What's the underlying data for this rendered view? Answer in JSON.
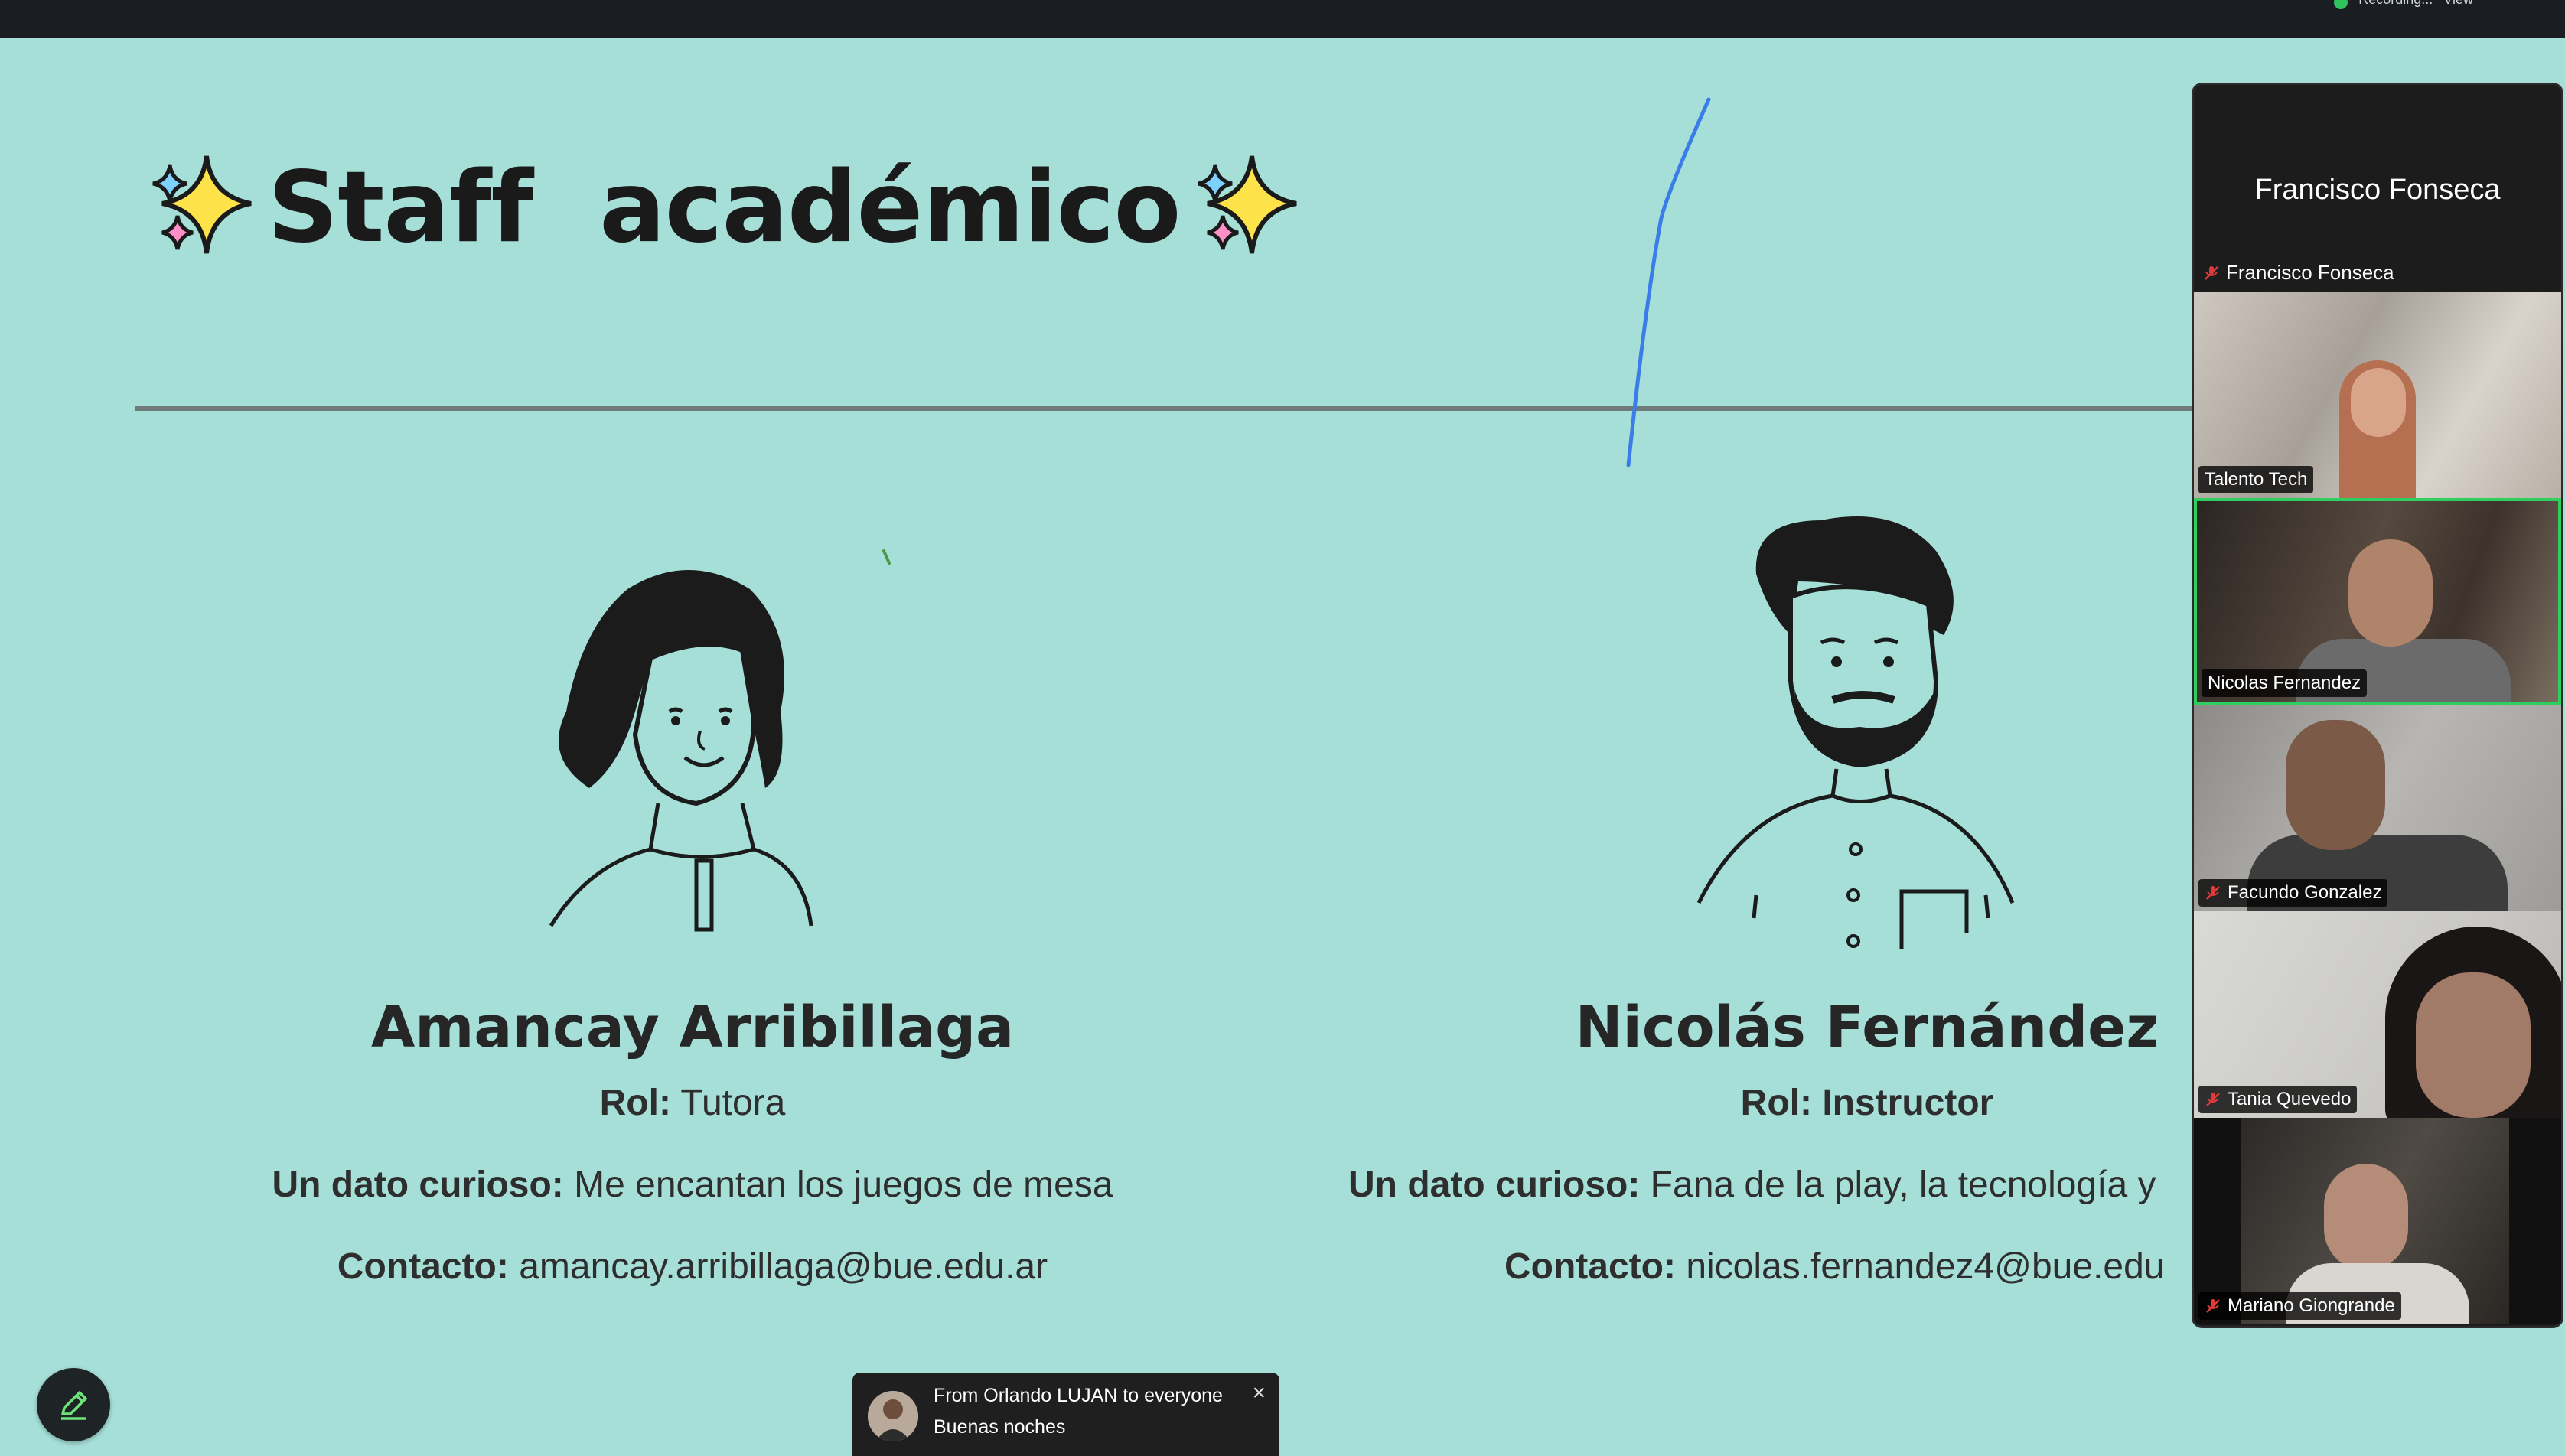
{
  "top_bar": {
    "recording_text": "Recording...",
    "view_label": "View"
  },
  "slide": {
    "title": "Staff  académico",
    "staff": [
      {
        "name": "Amancay Arribillaga",
        "rol_label": "Rol:",
        "rol_value": "Tutora",
        "dato_label": "Un dato curioso:",
        "dato_value": "Me encantan los juegos de mesa",
        "contacto_label": "Contacto:",
        "contacto_value": "amancay.arribillaga@bue.edu.ar"
      },
      {
        "name": "Nicolás Fernández",
        "rol_label": "Rol:",
        "rol_value": "Instructor",
        "dato_label": "Un dato curioso:",
        "dato_value": "Fana de la play, la tecnología y",
        "contacto_label": "Contacto:",
        "contacto_value": "nicolas.fernandez4@bue.edu"
      }
    ]
  },
  "participants": {
    "speaker_name": "Francisco Fonseca",
    "speaker_label": "Francisco Fonseca",
    "tiles": [
      {
        "name": "Talento Tech",
        "muted": false,
        "active": false
      },
      {
        "name": "Nicolas Fernandez",
        "muted": false,
        "active": true
      },
      {
        "name": "Facundo Gonzalez",
        "muted": true,
        "active": false
      },
      {
        "name": "Tania Quevedo",
        "muted": true,
        "active": false
      },
      {
        "name": "Mariano Giongrande",
        "muted": true,
        "active": false
      }
    ]
  },
  "chat_toast": {
    "header": "From Orlando LUJAN to everyone",
    "message": "Buenas noches"
  },
  "icons": {
    "edit": "pencil-icon",
    "close": "close-icon",
    "mute": "mic-muted-icon",
    "sparkle": "sparkles-icon"
  },
  "colors": {
    "slide_bg": "#a5dfd8",
    "active_border": "#2fcf5f",
    "pen_stroke": "#3a7de8"
  }
}
